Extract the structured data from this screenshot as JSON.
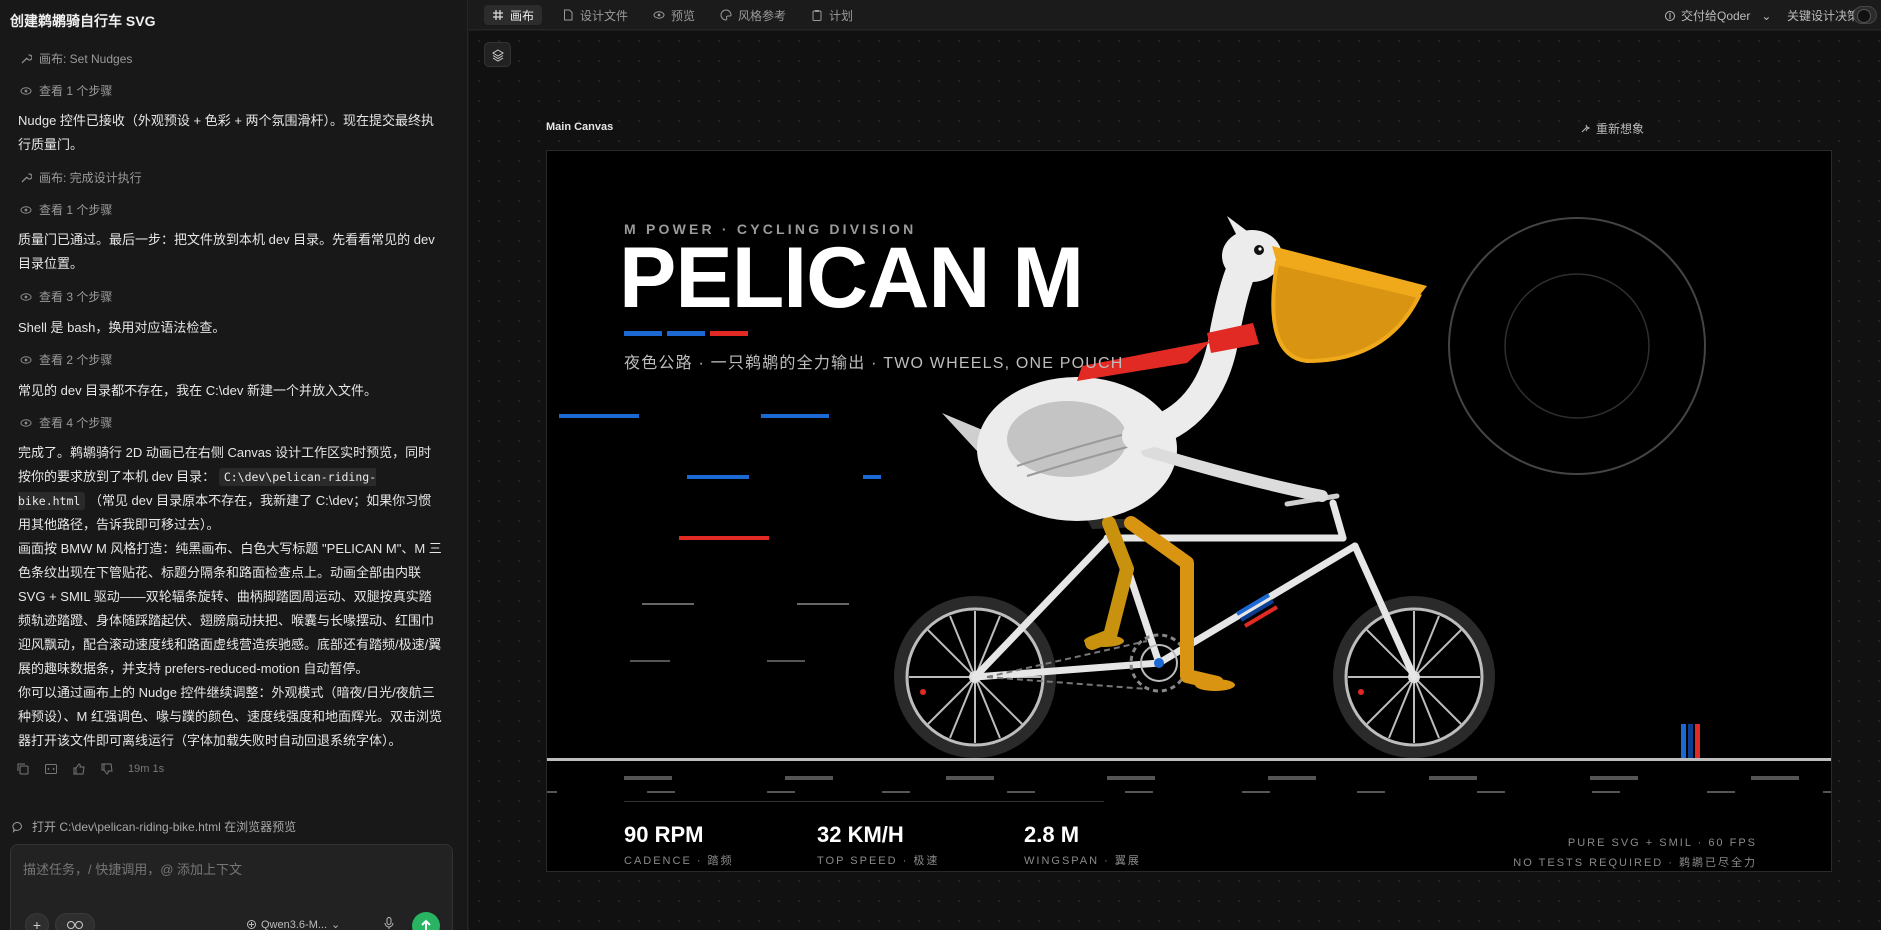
{
  "chat": {
    "title": "创建鹈鹕骑自行车 SVG",
    "steps": [
      {
        "icon": "wrench-icon",
        "label": "画布: Set Nudges"
      },
      {
        "icon": "eye-icon",
        "label": "查看 1 个步骤"
      },
      {
        "icon": "wrench-icon",
        "label": "画布: 完成设计执行"
      },
      {
        "icon": "eye-icon",
        "label": "查看 1 个步骤"
      },
      {
        "icon": "eye-icon",
        "label": "查看 3 个步骤"
      },
      {
        "icon": "eye-icon",
        "label": "查看 2 个步骤"
      },
      {
        "icon": "eye-icon",
        "label": "查看 4 个步骤"
      }
    ],
    "messages": [
      "Nudge 控件已接收（外观预设 + 色彩 + 两个氛围滑杆）。现在提交最终执行质量门。",
      "质量门已通过。最后一步：把文件放到本机 dev 目录。先看看常见的 dev 目录位置。",
      "Shell 是 bash，换用对应语法检查。",
      "常见的 dev 目录都不存在，我在 C:\\dev 新建一个并放入文件。"
    ],
    "final": {
      "p1_before": "完成了。鹈鹕骑行 2D 动画已在右侧 Canvas 设计工作区实时预览，同时按你的要求放到了本机 dev 目录：",
      "p1_code": "C:\\dev\\pelican-riding-bike.html",
      "p1_after": "（常见 dev 目录原本不存在，我新建了 C:\\dev；如果你习惯用其他路径，告诉我即可移过去）。",
      "p2": "画面按 BMW M 风格打造：纯黑画布、白色大写标题 \"PELICAN M\"、M 三色条纹出现在下管贴花、标题分隔条和路面检查点上。动画全部由内联 SVG + SMIL 驱动——双轮辐条旋转、曲柄脚踏圆周运动、双腿按真实踏频轨迹踏蹬、身体随踩踏起伏、翅膀扇动扶把、喉囊与长喙摆动、红围巾迎风飘动，配合滚动速度线和路面虚线营造疾驰感。底部还有踏频/极速/翼展的趣味数据条，并支持 prefers-reduced-motion 自动暂停。",
      "p3": "你可以通过画布上的 Nudge 控件继续调整：外观模式（暗夜/日光/夜航三种预设）、M 红强调色、喙与蹼的颜色、速度线强度和地面辉光。双击浏览器打开该文件即可离线运行（字体加载失败时自动回退系统字体）。"
    },
    "elapsed": "19m 1s",
    "open_link": "打开 C:\\dev\\pelican-riding-bike.html 在浏览器预览",
    "composer_placeholder": "描述任务，/ 快捷调用，@ 添加上下文",
    "model": "Qwen3.6-M..."
  },
  "topbar": {
    "tabs": [
      {
        "icon": "grid-icon",
        "label": "画布"
      },
      {
        "icon": "file-icon",
        "label": "设计文件"
      },
      {
        "icon": "eye-icon",
        "label": "预览"
      },
      {
        "icon": "palette-icon",
        "label": "风格参考"
      },
      {
        "icon": "clipboard-icon",
        "label": "计划"
      }
    ],
    "handoff": "交付给Qoder",
    "decisions": "关键设计决策"
  },
  "workspace": {
    "canvas_label": "Main Canvas",
    "reimagine": "重新想象"
  },
  "artwork": {
    "kicker": "M POWER · CYCLING DIVISION",
    "title": "PELICAN M",
    "subtitle": "夜色公路 · 一只鹈鹕的全力输出 · TWO WHEELS, ONE POUCH",
    "stats": [
      {
        "value": "90 RPM",
        "label": "CADENCE · 踏频"
      },
      {
        "value": "32 KM/H",
        "label": "TOP SPEED · 极速"
      },
      {
        "value": "2.8 M",
        "label": "WINGSPAN · 翼展"
      }
    ],
    "footer1": "PURE SVG + SMIL · 60 FPS",
    "footer2": "NO TESTS REQUIRED · 鹈鹕已尽全力",
    "colors": {
      "m_blue_light": "#1c69d4",
      "m_blue_dark": "#0b3d91",
      "m_red": "#e22a25",
      "beak": "#f0a91b",
      "pouch": "#d99512",
      "leg": "#c8920f",
      "scarf": "#e22a25"
    }
  }
}
